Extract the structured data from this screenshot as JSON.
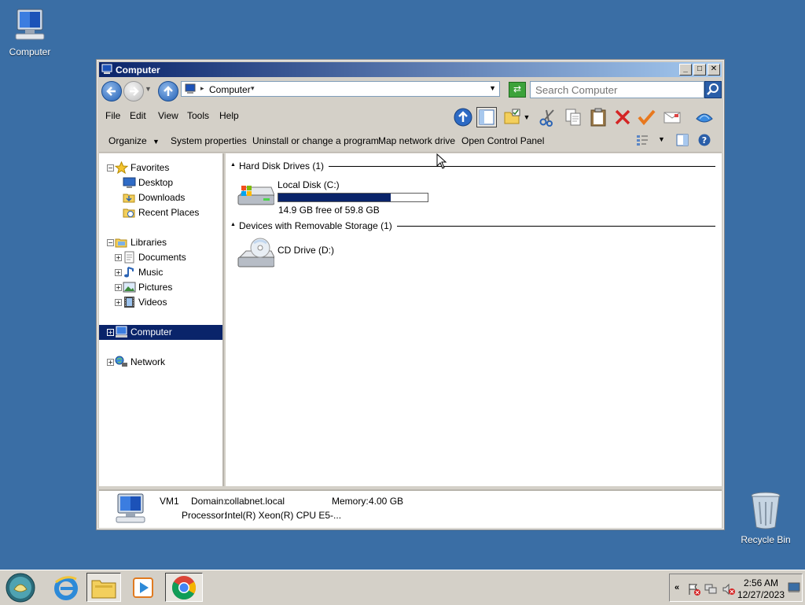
{
  "desktop": {
    "icons": [
      {
        "label": "Computer",
        "icon": "computer-icon"
      },
      {
        "label": "Recycle Bin",
        "icon": "recycle-bin-icon"
      }
    ]
  },
  "window": {
    "title": "Computer",
    "controls": {
      "minimize": "_",
      "maximize": "□",
      "close": "✕"
    },
    "address": {
      "location": "Computer"
    },
    "search": {
      "placeholder": "Search Computer"
    },
    "menu": [
      "File",
      "Edit",
      "View",
      "Tools",
      "Help"
    ],
    "commands": [
      "Organize",
      "System properties",
      "Uninstall or change a program",
      "Map network drive",
      "Open Control Panel"
    ],
    "nav": {
      "favorites": {
        "label": "Favorites",
        "items": [
          "Desktop",
          "Downloads",
          "Recent Places"
        ]
      },
      "libraries": {
        "label": "Libraries",
        "items": [
          "Documents",
          "Music",
          "Pictures",
          "Videos"
        ]
      },
      "computer": "Computer",
      "network": "Network"
    },
    "content": {
      "groups": [
        {
          "title": "Hard Disk Drives (1)",
          "drives": [
            {
              "name": "Local Disk (C:)",
              "free_text": "14.9 GB free of 59.8 GB",
              "used_fraction": 0.75
            }
          ]
        },
        {
          "title": "Devices with Removable Storage (1)",
          "drives": [
            {
              "name": "CD Drive (D:)"
            }
          ]
        }
      ]
    },
    "details": {
      "name": "VM1",
      "domain_label": "Domain:",
      "domain_value": "collabnet.local",
      "memory_label": "Memory:",
      "memory_value": "4.00 GB",
      "processor_label": "Processor:",
      "processor_value": "Intel(R) Xeon(R) CPU E5-..."
    }
  },
  "taskbar": {
    "clock": {
      "time": "2:56 AM",
      "date": "12/27/2023"
    },
    "tray_arrow": "«"
  },
  "colors": {
    "desktop": "#3a6ea5",
    "selection": "#0a246a",
    "title_gradient_end": "#a6caf0",
    "chrome": "#d4d0c8"
  }
}
